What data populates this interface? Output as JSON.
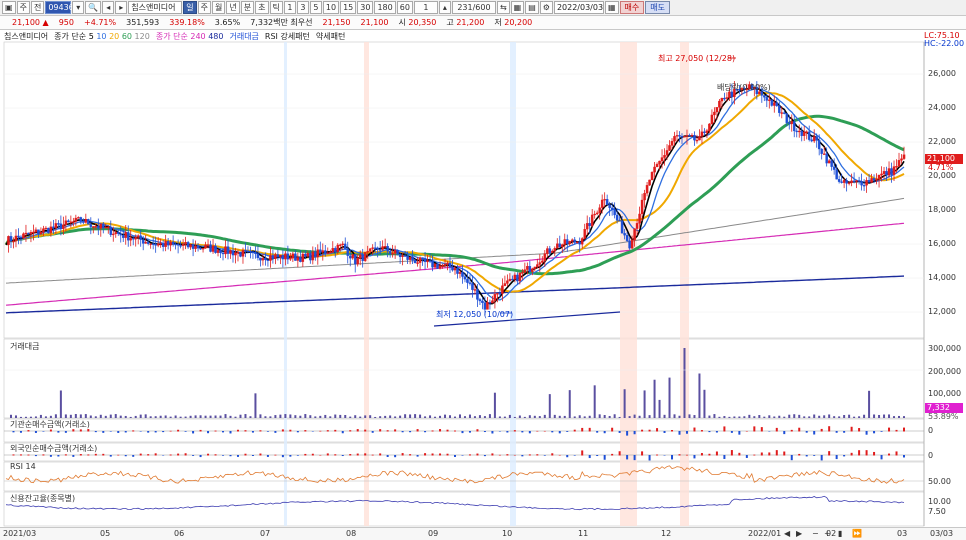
{
  "toolbar": {
    "btn_jong": "주",
    "btn_jeon": "전",
    "code": "094360",
    "name": "칩스앤미디어",
    "btn_ju": "주",
    "periods": [
      "일",
      "주",
      "월",
      "년",
      "분",
      "초",
      "틱"
    ],
    "minutes": [
      "1",
      "3",
      "5",
      "10",
      "15",
      "30",
      "180",
      "60"
    ],
    "count": "1",
    "range": "231/600",
    "date": "2022/03/03",
    "buy_label": "매수",
    "sell_label": "매도"
  },
  "quote": {
    "price": "21,100",
    "arrow": "▲",
    "change": "950",
    "change_pct": "+4.71%",
    "volume": "351,593",
    "vol_ratio": "339.18%",
    "turnover": "3.65%",
    "amount": "7,332백만",
    "best_label": "최우선",
    "best_ask": "21,150",
    "best_bid": "21,100",
    "open_label": "시",
    "open": "20,350",
    "high_label": "고",
    "high": "21,200",
    "low_label": "저",
    "low": "20,200"
  },
  "legend": {
    "name": "칩스앤미디어",
    "ma_label": "종가 단순",
    "ma_periods": [
      "5",
      "10",
      "20",
      "60",
      "120"
    ],
    "ma2_label": "종가 단순",
    "ma2_periods": [
      "240",
      "480"
    ],
    "vol_label": "거래대금",
    "rsi_label": "RSI 강세패턴",
    "rsi_weak": "약세패턴"
  },
  "colors": {
    "up": "#e01c1c",
    "down": "#1e4fd6",
    "ma5": "#000000",
    "ma10": "#2f6fe0",
    "ma20": "#f0a800",
    "ma60": "#2e9e55",
    "ma120": "#8a8a8a",
    "ma240": "#d52bb5",
    "ma480": "#1a2a9c"
  },
  "price_panel": {
    "lc": "LC:75.10",
    "hc": "HC:-22.00",
    "axis": [
      "26,000",
      "24,000",
      "22,000",
      "20,000",
      "18,000",
      "16,000",
      "14,000",
      "12,000"
    ],
    "current": "21,100",
    "current_pct": "4.71%",
    "high_note": "최고 27,050 (12/28)",
    "low_note": "최저 12,050 (10/07)",
    "dividend_note": "배당락(0.00%)"
  },
  "volume_panel": {
    "title": "거래대금",
    "axis": [
      "300,000",
      "200,000",
      "100,000"
    ],
    "current": "7,332",
    "current_pct": "53.89%"
  },
  "inst_panel": {
    "title": "기관순매수금액(거래소)",
    "axis_zero": "0"
  },
  "foreign_panel": {
    "title": "외국인순매수금액(거래소)",
    "axis_zero": "0"
  },
  "rsi_panel": {
    "title": "RSI 14",
    "axis": [
      "50.00"
    ]
  },
  "credit_panel": {
    "title": "신용잔고율(종목별)",
    "axis": [
      "10.00",
      "7.50"
    ]
  },
  "xaxis": [
    "2021/03",
    "05",
    "06",
    "07",
    "08",
    "09",
    "10",
    "11",
    "12",
    "2022/01",
    "02",
    "03",
    "03/03"
  ],
  "chart_data": {
    "type": "candlestick",
    "title": "칩스앤미디어",
    "ylim": [
      11500,
      27500
    ],
    "period": "2021/03 - 2022/03/03",
    "last": {
      "open": 20350,
      "high": 21200,
      "low": 20200,
      "close": 21100
    },
    "all_time_high": {
      "value": 27050,
      "date": "12/28"
    },
    "low_point": {
      "value": 12050,
      "date": "10/07"
    }
  }
}
